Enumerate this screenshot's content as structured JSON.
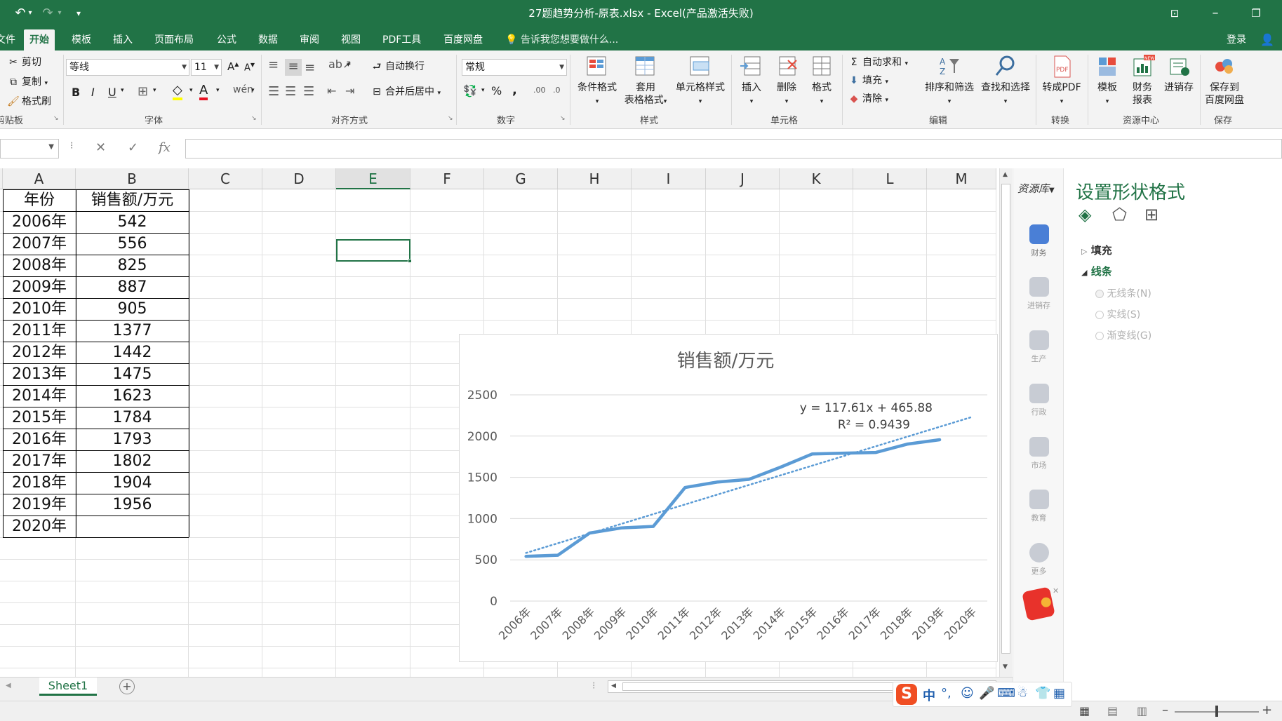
{
  "window": {
    "title": "27题趋势分析-原表.xlsx - Excel(产品激活失败)"
  },
  "tabs": [
    {
      "label": "文件"
    },
    {
      "label": "开始"
    },
    {
      "label": "模板"
    },
    {
      "label": "插入"
    },
    {
      "label": "页面布局"
    },
    {
      "label": "公式"
    },
    {
      "label": "数据"
    },
    {
      "label": "审阅"
    },
    {
      "label": "视图"
    },
    {
      "label": "PDF工具"
    },
    {
      "label": "百度网盘"
    }
  ],
  "tell_me": "告诉我您想要做什么...",
  "login": "登录",
  "ribbon": {
    "clipboard": {
      "cut": "剪切",
      "copy": "复制",
      "format_painter": "格式刷",
      "label": "剪贴板"
    },
    "font": {
      "name": "等线",
      "size": "11",
      "bold": "B",
      "italic": "I",
      "underline": "U",
      "label": "字体"
    },
    "align": {
      "wrap": "自动换行",
      "merge": "合并后居中",
      "label": "对齐方式"
    },
    "number": {
      "format": "常规",
      "percent": "%",
      "comma": ",",
      "label": "数字"
    },
    "styles": {
      "cond": "条件格式",
      "table1": "套用",
      "table2": "表格格式",
      "cell": "单元格样式",
      "label": "样式"
    },
    "cells": {
      "insert": "插入",
      "delete": "删除",
      "format": "格式",
      "label": "单元格"
    },
    "edit": {
      "autosum": "自动求和",
      "fill": "填充",
      "clear": "清除",
      "sort": "排序和筛选",
      "find": "查找和选择",
      "label": "编辑"
    },
    "convert": {
      "pdf": "转成PDF",
      "label": "转换"
    },
    "resource": {
      "template": "模板",
      "finance1": "财务",
      "finance2": "报表",
      "invoice": "进销存",
      "label": "资源中心"
    },
    "save": {
      "line1": "保存到",
      "line2": "百度网盘",
      "label": "保存"
    }
  },
  "formula_bar": {
    "fx": "fx",
    "namebox": "",
    "content": ""
  },
  "columns": [
    "A",
    "B",
    "C",
    "D",
    "E",
    "F",
    "G",
    "H",
    "I",
    "J",
    "K",
    "L",
    "M"
  ],
  "table": {
    "header": [
      "年份",
      "销售额/万元"
    ],
    "rows": [
      [
        "2006年",
        "542"
      ],
      [
        "2007年",
        "556"
      ],
      [
        "2008年",
        "825"
      ],
      [
        "2009年",
        "887"
      ],
      [
        "2010年",
        "905"
      ],
      [
        "2011年",
        "1377"
      ],
      [
        "2012年",
        "1442"
      ],
      [
        "2013年",
        "1475"
      ],
      [
        "2014年",
        "1623"
      ],
      [
        "2015年",
        "1784"
      ],
      [
        "2016年",
        "1793"
      ],
      [
        "2017年",
        "1802"
      ],
      [
        "2018年",
        "1904"
      ],
      [
        "2019年",
        "1956"
      ],
      [
        "2020年",
        ""
      ]
    ]
  },
  "chart_data": {
    "type": "line",
    "title": "销售额/万元",
    "categories": [
      "2006年",
      "2007年",
      "2008年",
      "2009年",
      "2010年",
      "2011年",
      "2012年",
      "2013年",
      "2014年",
      "2015年",
      "2016年",
      "2017年",
      "2018年",
      "2019年",
      "2020年"
    ],
    "series": [
      {
        "values": [
          542,
          556,
          825,
          887,
          905,
          1377,
          1442,
          1475,
          1623,
          1784,
          1793,
          1802,
          1904,
          1956,
          null
        ],
        "color": "#5b9bd5"
      }
    ],
    "trendline": {
      "type": "linear",
      "slope": 117.61,
      "intercept": 465.88,
      "equation": "y = 117.61x + 465.88",
      "r2": "R² = 0.9439",
      "color": "#5b9bd5"
    },
    "ylim": [
      0,
      2500
    ],
    "yticks": [
      "0",
      "500",
      "1000",
      "1500",
      "2000",
      "2500"
    ],
    "grid": true,
    "legend": "none"
  },
  "resource_panel": {
    "header": "资源库",
    "items": [
      "财务",
      "进销存",
      "生产",
      "行政",
      "市场",
      "教育",
      "更多"
    ]
  },
  "format_pane": {
    "title": "设置形状格式",
    "fill": "填充",
    "line": "线条",
    "options": [
      "无线条(N)",
      "实线(S)",
      "渐变线(G)"
    ]
  },
  "sheet": {
    "name": "Sheet1",
    "add": "+"
  },
  "ime": {
    "chinese": "中"
  },
  "colors": {
    "accent": "#217346",
    "series": "#5b9bd5"
  }
}
